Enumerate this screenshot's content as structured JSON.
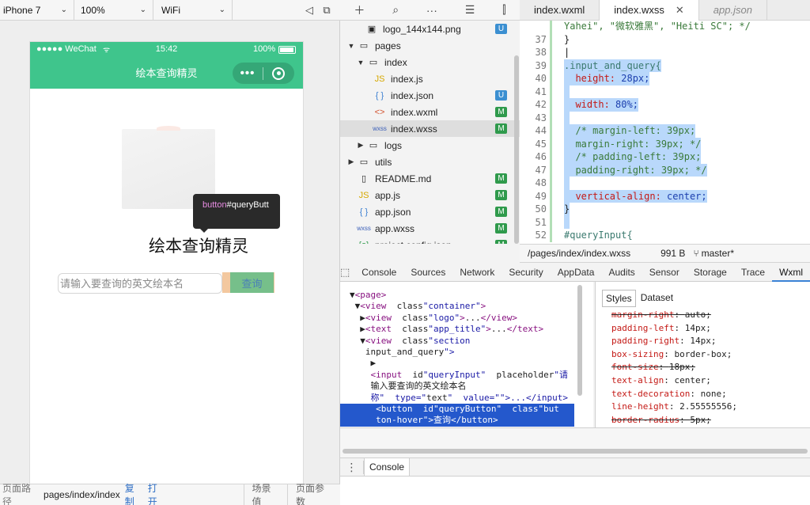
{
  "simulator": {
    "device": "iPhone 7",
    "zoom": "100%",
    "network": "WiFi",
    "phone": {
      "carrier": "●●●●● WeChat",
      "time": "15:42",
      "battery": "100%",
      "nav_title": "绘本查询精灵",
      "app_title": "绘本查询精灵",
      "query_placeholder": "请输入要查询的英文绘本名",
      "query_button": "查询",
      "tooltip_tag": "button",
      "tooltip_id": "#queryButt"
    },
    "footer": {
      "path_label": "页面路径",
      "path_value": "pages/index/index",
      "copy": "复制",
      "open": "打开",
      "scene": "场景值",
      "params": "页面参数"
    }
  },
  "file_tree": [
    {
      "name": "logo_144x144.png",
      "badge": "U",
      "icon": "image-icon",
      "glyph": "▣"
    },
    {
      "name": "pages",
      "badge": "",
      "icon": "folder-open-icon",
      "glyph": "▭"
    },
    {
      "name": "index",
      "badge": "",
      "icon": "folder-open-icon",
      "glyph": "▭"
    },
    {
      "name": "index.js",
      "badge": "",
      "icon": "js-file-icon",
      "glyph": "JS"
    },
    {
      "name": "index.json",
      "badge": "U",
      "icon": "json-file-icon",
      "glyph": "{ }"
    },
    {
      "name": "index.wxml",
      "badge": "M",
      "icon": "wxml-file-icon",
      "glyph": "<>"
    },
    {
      "name": "index.wxss",
      "badge": "M",
      "icon": "wxss-file-icon",
      "glyph": "wxss"
    },
    {
      "name": "logs",
      "badge": "",
      "icon": "folder-icon",
      "glyph": "▭"
    },
    {
      "name": "utils",
      "badge": "",
      "icon": "folder-icon",
      "glyph": "▭"
    },
    {
      "name": "README.md",
      "badge": "M",
      "icon": "file-icon",
      "glyph": "▯"
    },
    {
      "name": "app.js",
      "badge": "M",
      "icon": "js-file-icon",
      "glyph": "JS"
    },
    {
      "name": "app.json",
      "badge": "M",
      "icon": "json-file-icon",
      "glyph": "{ }"
    },
    {
      "name": "app.wxss",
      "badge": "M",
      "icon": "wxss-file-icon",
      "glyph": "wxss"
    },
    {
      "name": "project.config.json",
      "badge": "M",
      "icon": "config-file-icon",
      "glyph": "{o}"
    }
  ],
  "editor": {
    "tabs": [
      "index.wxml",
      "index.wxss",
      "app.json"
    ],
    "close_glyph": "✕",
    "lines": [
      {
        "n": "",
        "text": "Yahei\", \"微软雅黑\", \"Heiti SC\"; */"
      },
      {
        "n": "37",
        "text": "}"
      },
      {
        "n": "38",
        "text": ""
      },
      {
        "n": "39",
        "text": ".input_and_query{"
      },
      {
        "n": "40",
        "text": "  height: 28px;"
      },
      {
        "n": "41",
        "text": ""
      },
      {
        "n": "42",
        "text": "  width: 80%;"
      },
      {
        "n": "43",
        "text": ""
      },
      {
        "n": "44",
        "text": "  /* margin-left: 39px;"
      },
      {
        "n": "45",
        "text": "  margin-right: 39px; */"
      },
      {
        "n": "46",
        "text": "  /* padding-left: 39px;"
      },
      {
        "n": "47",
        "text": "  padding-right: 39px; */"
      },
      {
        "n": "48",
        "text": ""
      },
      {
        "n": "49",
        "text": "  vertical-align: center;"
      },
      {
        "n": "50",
        "text": "}"
      },
      {
        "n": "51",
        "text": ""
      },
      {
        "n": "52",
        "text": "#queryInput{"
      }
    ],
    "status": {
      "path": "/pages/index/index.wxss",
      "size": "991 B",
      "branch": "master*"
    }
  },
  "devtools": {
    "tabs": [
      "Console",
      "Sources",
      "Network",
      "Security",
      "AppData",
      "Audits",
      "Sensor",
      "Storage",
      "Trace",
      "Wxml"
    ],
    "dom_lines": [
      "▼<page>",
      " ▼<view  class=\"container\">",
      "  ▶<view  class=\"logo\">...</view>",
      "  ▶<text  class=\"app_title\">...</text>",
      "  ▼<view  class=\"section",
      "   input_and_query\">",
      "    ▶",
      "    <input  id=\"queryInput\"  placeholder=\"请",
      "    输入要查询的英文绘本名",
      "    称\"  type=\"text\"  value=\"\">...</input>",
      "     <button  id=\"queryButton\"  class=\"but",
      "     ton-hover\">查询</button>"
    ],
    "styles_tabs": [
      "Styles",
      "Dataset"
    ],
    "style_rules": [
      {
        "prop": "margin-right",
        "value": "auto",
        "strike": true
      },
      {
        "prop": "padding-left",
        "value": "14px",
        "strike": false
      },
      {
        "prop": "padding-right",
        "value": "14px",
        "strike": false
      },
      {
        "prop": "box-sizing",
        "value": "border-box",
        "strike": false
      },
      {
        "prop": "font-size",
        "value": "18px",
        "strike": true
      },
      {
        "prop": "text-align",
        "value": "center",
        "strike": false
      },
      {
        "prop": "text-decoration",
        "value": "none",
        "strike": false
      },
      {
        "prop": "line-height",
        "value": "2.55555556",
        "strike": false
      },
      {
        "prop": "border-radius",
        "value": "5px",
        "strike": true
      }
    ],
    "console_tab": "Console"
  },
  "colors": {
    "wechat_green": "#3fc58c",
    "selection_blue": "#2458cc",
    "code_highlight": "#b9d8fb",
    "badge_modified": "#2f9a4c",
    "badge_untracked": "#3b8fd1"
  }
}
